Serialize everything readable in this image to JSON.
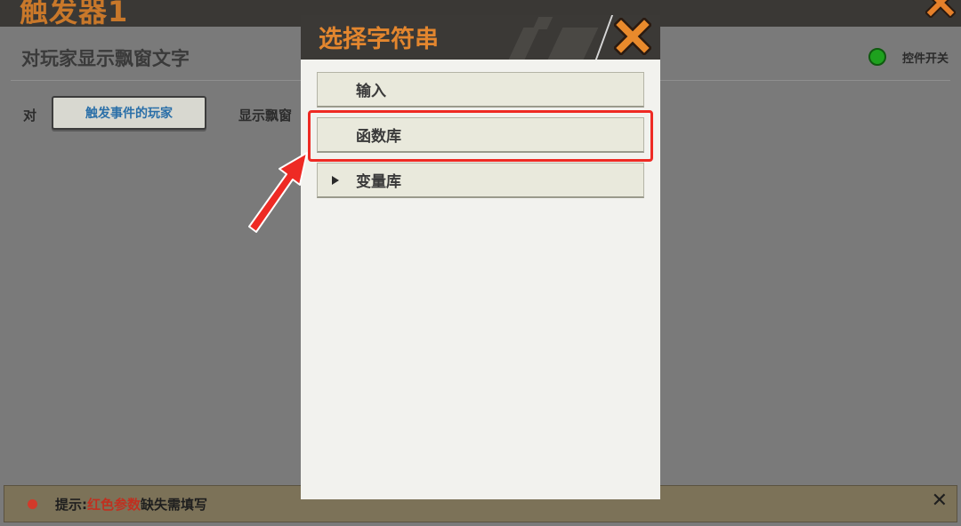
{
  "window": {
    "title": "触发器1"
  },
  "panel": {
    "title": "对玩家显示飘窗文字",
    "toggle_label": "控件开关",
    "row_prefix": "对",
    "player_button": "触发事件的玩家",
    "row_suffix": "显示飘窗"
  },
  "dialog": {
    "title": "选择字符串",
    "options": [
      {
        "label": "输入",
        "has_arrow": false
      },
      {
        "label": "函数库",
        "has_arrow": false,
        "highlighted": true
      },
      {
        "label": "变量库",
        "has_arrow": true
      }
    ]
  },
  "tip": {
    "prefix": "提示: ",
    "highlight": "红色参数",
    "suffix": "缺失需填写"
  },
  "colors": {
    "accent_orange": "#e3862e",
    "highlight_red": "#ee2a24",
    "toggle_green": "#1ea11e",
    "player_link_blue": "#2a6fa8"
  },
  "icons": {
    "window_close": "close-x-icon",
    "dialog_close": "close-x-icon",
    "tip_close": "close-icon",
    "toggle_status": "green-dot-icon",
    "tip_status": "red-dot-icon",
    "expand": "triangle-right-icon",
    "annotation": "red-pointer-arrow"
  }
}
